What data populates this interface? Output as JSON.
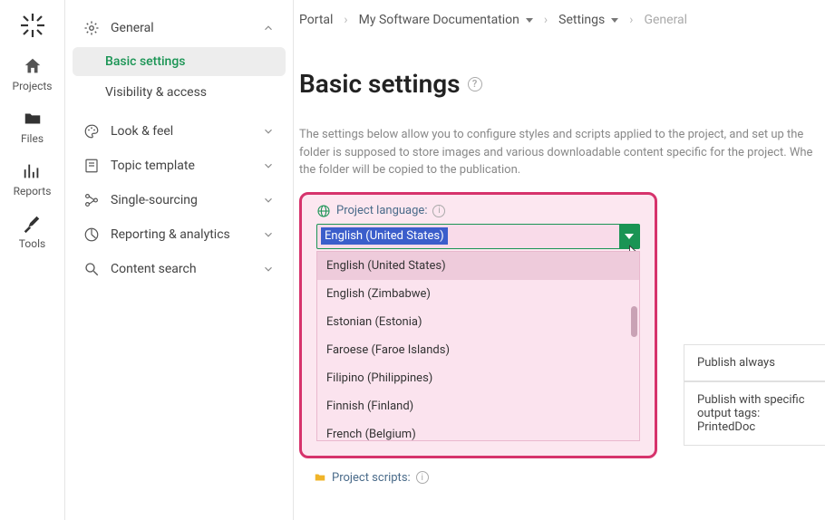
{
  "rail": {
    "items": [
      {
        "label": "Projects"
      },
      {
        "label": "Files"
      },
      {
        "label": "Reports"
      },
      {
        "label": "Tools"
      }
    ]
  },
  "sidebar": {
    "general": {
      "label": "General"
    },
    "subs": [
      {
        "label": "Basic settings"
      },
      {
        "label": "Visibility & access"
      }
    ],
    "items": [
      {
        "label": "Look & feel"
      },
      {
        "label": "Topic template"
      },
      {
        "label": "Single-sourcing"
      },
      {
        "label": "Reporting & analytics"
      },
      {
        "label": "Content search"
      }
    ]
  },
  "breadcrumbs": {
    "a": "Portal",
    "b": "My Software Documentation",
    "c": "Settings",
    "d": "General"
  },
  "page": {
    "title": "Basic settings",
    "description": "The settings below allow you to configure styles and scripts applied to the project, and set up the folder is supposed to store images and various downloadable content specific for the project. Whe the folder will be copied to the publication."
  },
  "lang": {
    "label": "Project language:",
    "selected": "English (United States)",
    "options": [
      "English (United States)",
      "English (Zimbabwe)",
      "Estonian (Estonia)",
      "Faroese (Faroe Islands)",
      "Filipino (Philippines)",
      "Finnish (Finland)",
      "French (Belgium)"
    ]
  },
  "scripts": {
    "label": "Project scripts:"
  },
  "publish": {
    "a": "Publish always",
    "b": "Publish with specific output tags: PrintedDoc"
  }
}
